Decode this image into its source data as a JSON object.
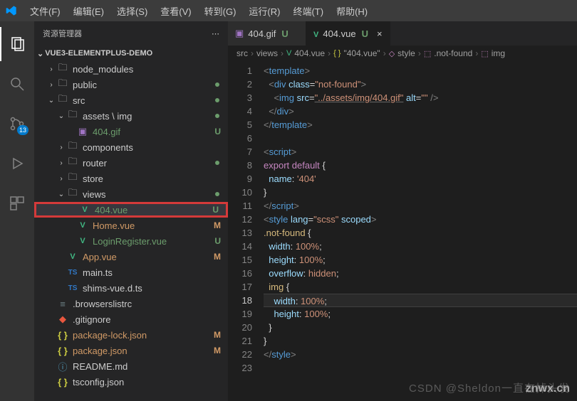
{
  "menu": [
    "文件(F)",
    "编辑(E)",
    "选择(S)",
    "查看(V)",
    "转到(G)",
    "运行(R)",
    "终端(T)",
    "帮助(H)"
  ],
  "sidebar": {
    "title": "资源管理器",
    "project": "VUE3-ELEMENTPLUS-DEMO"
  },
  "scmBadge": "13",
  "tree": [
    {
      "ind": 1,
      "chev": "›",
      "type": "folder",
      "label": "node_modules"
    },
    {
      "ind": 1,
      "chev": "›",
      "type": "folder",
      "label": "public",
      "gitDot": "u"
    },
    {
      "ind": 1,
      "chev": "⌄",
      "type": "folder",
      "label": "src",
      "gitDot": "u"
    },
    {
      "ind": 2,
      "chev": "⌄",
      "type": "folder",
      "label": "assets \\ img",
      "gitDot": "u"
    },
    {
      "ind": 3,
      "chev": "",
      "type": "gif",
      "label": "404.gif",
      "gitStatus": "U",
      "gitClass": "u"
    },
    {
      "ind": 2,
      "chev": "›",
      "type": "folder",
      "label": "components"
    },
    {
      "ind": 2,
      "chev": "›",
      "type": "folder",
      "label": "router",
      "gitDot": "u"
    },
    {
      "ind": 2,
      "chev": "›",
      "type": "folder",
      "label": "store"
    },
    {
      "ind": 2,
      "chev": "⌄",
      "type": "folder",
      "label": "views",
      "gitDot": "u"
    },
    {
      "ind": 3,
      "chev": "",
      "type": "vue",
      "label": "404.vue",
      "gitStatus": "U",
      "gitClass": "u",
      "selected": true,
      "highlight": true
    },
    {
      "ind": 3,
      "chev": "",
      "type": "vue",
      "label": "Home.vue",
      "gitStatus": "M",
      "gitClass": "m"
    },
    {
      "ind": 3,
      "chev": "",
      "type": "vue",
      "label": "LoginRegister.vue",
      "gitStatus": "U",
      "gitClass": "u"
    },
    {
      "ind": 2,
      "chev": "",
      "type": "vue",
      "label": "App.vue",
      "gitStatus": "M",
      "gitClass": "m"
    },
    {
      "ind": 2,
      "chev": "",
      "type": "ts",
      "label": "main.ts"
    },
    {
      "ind": 2,
      "chev": "",
      "type": "ts",
      "label": "shims-vue.d.ts"
    },
    {
      "ind": 1,
      "chev": "",
      "type": "config",
      "label": ".browserslistrc"
    },
    {
      "ind": 1,
      "chev": "",
      "type": "git",
      "label": ".gitignore"
    },
    {
      "ind": 1,
      "chev": "",
      "type": "json",
      "label": "package-lock.json",
      "gitStatus": "M",
      "gitClass": "m"
    },
    {
      "ind": 1,
      "chev": "",
      "type": "json",
      "label": "package.json",
      "gitStatus": "M",
      "gitClass": "m"
    },
    {
      "ind": 1,
      "chev": "",
      "type": "md",
      "label": "README.md"
    },
    {
      "ind": 1,
      "chev": "",
      "type": "json",
      "label": "tsconfig.json"
    }
  ],
  "tabs": [
    {
      "icon": "gif",
      "label": "404.gif",
      "status": "U",
      "active": false
    },
    {
      "icon": "vue",
      "label": "404.vue",
      "status": "U",
      "active": true
    }
  ],
  "breadcrumb": [
    "src",
    "views",
    "404.vue",
    "\"404.vue\"",
    "style",
    ".not-found",
    "img"
  ],
  "code": {
    "lines": 23,
    "current": 18
  },
  "watermark1": "CSDN @Sheldon一直在掉头发",
  "watermark2": "znwx.cn"
}
